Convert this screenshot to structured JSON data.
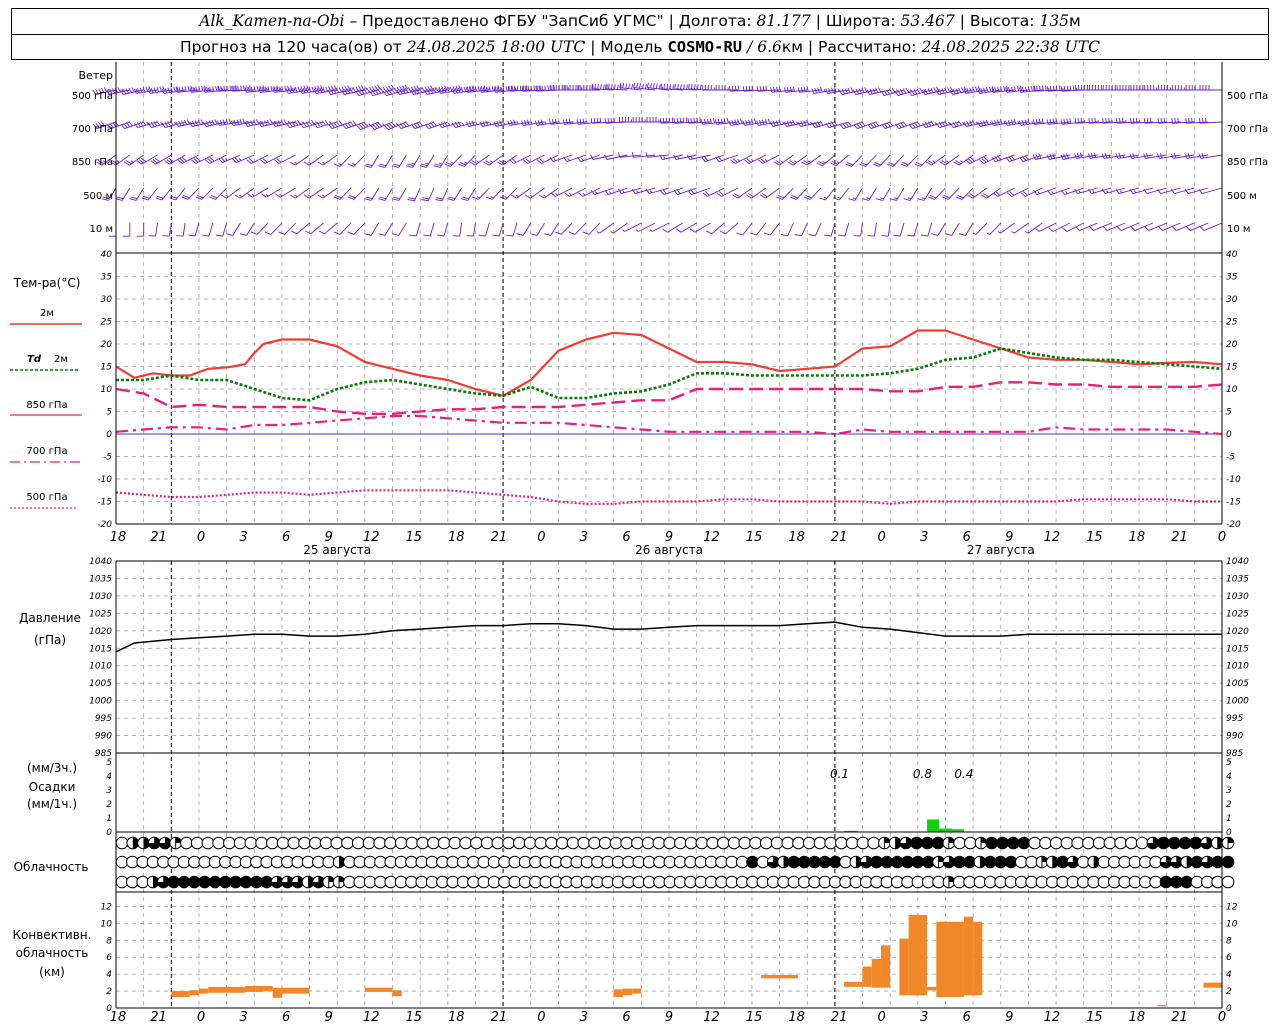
{
  "header": {
    "station": "Alk_Kamen-na-Obi",
    "provider": "– Предоставлено ФГБУ \"ЗапСиб УГМС\"",
    "lon_label": "Долгота:",
    "lon": "81.177",
    "lat_label": "Широта:",
    "lat": "53.467",
    "alt_label": "Высота:",
    "alt": "135",
    "alt_unit": "м",
    "forecast_label": "Прогноз на 120 часа(ов)  от",
    "forecast_start": "24.08.2025 18:00 UTC",
    "model_label": "Модель",
    "model": "COSMO-RU",
    "resolution": "/ 6.6",
    "res_unit": "км",
    "calc_label": "Рассчитано:",
    "calc_time": "24.08.2025 22:38 UTC"
  },
  "labels": {
    "wind": "Ветер",
    "wind_levels": [
      "500 гПа",
      "700 гПа",
      "850 гПа",
      "500 м",
      "10  м"
    ],
    "temp_title": "Тем-ра(°С)",
    "temp_legend": [
      {
        "text": "2м",
        "prefix": ""
      },
      {
        "text": "2м",
        "prefix": "Td"
      },
      {
        "text": "850 гПа",
        "prefix": ""
      },
      {
        "text": "700 гПа",
        "prefix": ""
      },
      {
        "text": "500 гПа",
        "prefix": ""
      }
    ],
    "pressure_title": "Давление",
    "pressure_unit": "(гПа)",
    "precip_unit_top": "(мм/3ч.)",
    "precip_title": "Осадки",
    "precip_unit_bottom": "(мм/1ч.)",
    "cloud_title": "Облачность",
    "conv_title": [
      "Конвективн.",
      "облачность",
      "(км)"
    ]
  },
  "colors": {
    "wind": "#6a1fd0",
    "t2m": "#f03c32",
    "td": "#0a7a0a",
    "t850": "#e8207a",
    "t700": "#e8207a",
    "t500": "#e8207a",
    "zero_line": "#3030ff",
    "pressure": "#000000",
    "precip": "#10d010",
    "conv": "#f0882a",
    "grid": "#a0a0a0"
  },
  "chart_data": {
    "type": "meteogram",
    "time_ticks": [
      "18",
      "21",
      "0",
      "3",
      "6",
      "9",
      "12",
      "15",
      "18",
      "21",
      "0",
      "3",
      "6",
      "9",
      "12",
      "15",
      "18",
      "21",
      "0",
      "3",
      "6",
      "9",
      "12",
      "15",
      "18",
      "21",
      "0"
    ],
    "days": [
      "25 августа",
      "26 августа",
      "27 августа"
    ],
    "temperature": {
      "ylim": [
        -20,
        40
      ],
      "yticks": [
        40,
        35,
        30,
        25,
        20,
        15,
        10,
        5,
        0,
        -5,
        -10,
        -15,
        -20
      ],
      "series": [
        {
          "key": "t2m",
          "style": "solid",
          "x": [
            0,
            2,
            4,
            6,
            8,
            10,
            12,
            14,
            15,
            16,
            18,
            21,
            24,
            27,
            30,
            33,
            36,
            39,
            42,
            45,
            48,
            51,
            54,
            57,
            60,
            63,
            66,
            69,
            72,
            75,
            78,
            81,
            84,
            87,
            90,
            93,
            96,
            99,
            102,
            105,
            108,
            111,
            114,
            117,
            120
          ],
          "y": [
            15,
            12.5,
            13.5,
            13,
            13,
            14.5,
            14.8,
            15.5,
            18,
            20,
            21,
            21,
            19.5,
            16,
            14.5,
            13,
            12,
            10,
            8.5,
            12,
            18.5,
            21,
            22.5,
            22,
            19,
            16,
            16,
            15.5,
            14,
            14.5,
            15,
            19,
            19.5,
            23,
            23,
            21,
            19,
            17,
            16.5,
            16.5,
            16,
            15.5,
            15.8,
            16,
            15.5
          ]
        },
        {
          "key": "td",
          "style": "dotted-bold",
          "x": [
            0,
            3,
            6,
            9,
            12,
            15,
            18,
            21,
            24,
            27,
            30,
            33,
            36,
            39,
            42,
            45,
            48,
            51,
            54,
            57,
            60,
            63,
            66,
            69,
            72,
            75,
            78,
            81,
            84,
            87,
            90,
            93,
            96,
            99,
            102,
            105,
            108,
            111,
            114,
            117,
            120
          ],
          "y": [
            12,
            12,
            13,
            12,
            12,
            10,
            8,
            7.5,
            10,
            11.5,
            12,
            11,
            10,
            9,
            8.5,
            10.5,
            8,
            8,
            9,
            9.5,
            11,
            13.5,
            13.5,
            13,
            13,
            13,
            13,
            13,
            13.5,
            14.5,
            16.5,
            17,
            19,
            18,
            17,
            16.5,
            16.5,
            16,
            15.5,
            15,
            14.5
          ]
        },
        {
          "key": "t850",
          "style": "longdash",
          "x": [
            0,
            3,
            6,
            9,
            12,
            15,
            18,
            21,
            24,
            27,
            30,
            33,
            36,
            39,
            42,
            45,
            48,
            51,
            54,
            57,
            60,
            63,
            66,
            69,
            72,
            75,
            78,
            81,
            84,
            87,
            90,
            93,
            96,
            99,
            102,
            105,
            108,
            111,
            114,
            117,
            120
          ],
          "y": [
            10,
            9,
            6,
            6.5,
            6,
            6,
            6,
            6,
            5,
            4.5,
            4.5,
            5,
            5.5,
            5.5,
            6,
            6,
            6,
            6.5,
            7,
            7.5,
            7.5,
            10,
            10,
            10,
            10,
            10,
            10,
            10,
            9.5,
            9.5,
            10.5,
            10.5,
            11.5,
            11.5,
            11,
            11,
            10.5,
            10.5,
            10.5,
            10.5,
            11
          ]
        },
        {
          "key": "t700",
          "style": "dashdot",
          "x": [
            0,
            3,
            6,
            9,
            12,
            15,
            18,
            21,
            24,
            27,
            30,
            33,
            36,
            39,
            42,
            45,
            48,
            51,
            54,
            57,
            60,
            63,
            66,
            69,
            72,
            75,
            78,
            81,
            84,
            87,
            90,
            93,
            96,
            99,
            102,
            105,
            108,
            111,
            114,
            117,
            120
          ],
          "y": [
            0.5,
            1,
            1.5,
            1.5,
            1,
            2,
            2,
            2.5,
            3,
            3.5,
            4,
            4,
            3.5,
            3,
            2.5,
            2.5,
            2.5,
            2,
            1.5,
            1,
            0.5,
            0.5,
            0.5,
            0.5,
            0.5,
            0.5,
            0,
            1,
            0.5,
            0.5,
            0.5,
            0.5,
            0.5,
            0.5,
            1.5,
            1,
            1,
            1,
            1,
            0.5,
            0
          ]
        },
        {
          "key": "t500",
          "style": "dotted",
          "x": [
            0,
            3,
            6,
            9,
            12,
            15,
            18,
            21,
            24,
            27,
            30,
            33,
            36,
            39,
            42,
            45,
            48,
            51,
            54,
            57,
            60,
            63,
            66,
            69,
            72,
            75,
            78,
            81,
            84,
            87,
            90,
            93,
            96,
            99,
            102,
            105,
            108,
            111,
            114,
            117,
            120
          ],
          "y": [
            -13,
            -13.5,
            -14,
            -14,
            -13.5,
            -13,
            -13,
            -13.5,
            -13,
            -12.5,
            -12.5,
            -12.5,
            -12.5,
            -13,
            -13.5,
            -14,
            -15,
            -15.5,
            -15.5,
            -15,
            -15,
            -15,
            -14.5,
            -14.5,
            -15,
            -15,
            -15,
            -15,
            -15.5,
            -15,
            -15,
            -15,
            -15,
            -15,
            -15,
            -14.5,
            -14.5,
            -14.5,
            -14.5,
            -15,
            -15
          ]
        }
      ]
    },
    "pressure": {
      "ylim": [
        985,
        1040
      ],
      "yticks": [
        1040,
        1035,
        1030,
        1025,
        1020,
        1015,
        1010,
        1005,
        1000,
        995,
        990,
        985
      ],
      "x": [
        0,
        2,
        4,
        6,
        9,
        12,
        15,
        18,
        21,
        24,
        27,
        30,
        33,
        36,
        39,
        42,
        45,
        48,
        51,
        54,
        57,
        60,
        63,
        66,
        69,
        72,
        75,
        78,
        81,
        84,
        87,
        90,
        93,
        96,
        99,
        102,
        105,
        108,
        111,
        114,
        117,
        120
      ],
      "y": [
        1014,
        1016.5,
        1017,
        1017.5,
        1018,
        1018.5,
        1019,
        1019,
        1018.5,
        1018.5,
        1019,
        1020,
        1020.5,
        1021,
        1021.5,
        1021.5,
        1022,
        1022,
        1021.5,
        1020.5,
        1020.5,
        1021,
        1021.5,
        1021.5,
        1021.5,
        1021.5,
        1022,
        1022.5,
        1021,
        1020.5,
        1019.5,
        1018.5,
        1018.5,
        1018.5,
        1019,
        1019,
        1019,
        1019,
        1019,
        1019,
        1019,
        1019
      ]
    },
    "precipitation": {
      "ylim": [
        0,
        5
      ],
      "yticks": [
        5,
        4,
        3,
        2,
        1,
        0
      ],
      "bars": [
        {
          "x": 79,
          "w": 1.5,
          "v": 0.08
        },
        {
          "x": 88,
          "w": 1.3,
          "v": 0.9
        },
        {
          "x": 89.3,
          "w": 1.4,
          "v": 0.25
        },
        {
          "x": 90.7,
          "w": 1.3,
          "v": 0.2
        }
      ],
      "labels": [
        {
          "x": 78.5,
          "text": "0.1"
        },
        {
          "x": 87.5,
          "text": "0.8"
        },
        {
          "x": 92,
          "text": "0.4"
        }
      ]
    },
    "cloudiness": {
      "rows": [
        [
          0,
          4,
          4,
          6,
          6,
          2,
          0,
          0,
          0,
          0,
          0,
          0,
          0,
          0,
          0,
          0,
          0,
          0,
          0,
          0,
          0,
          0,
          0,
          0,
          0,
          0,
          0,
          0,
          0,
          0,
          0,
          0,
          0,
          0,
          0,
          0,
          0,
          0,
          0,
          0,
          0,
          0,
          0,
          0,
          0,
          0,
          0,
          0,
          0,
          0,
          0,
          0,
          0,
          0,
          0,
          0,
          0,
          0,
          0,
          0,
          0,
          0,
          0,
          0,
          0,
          0,
          0,
          0,
          0,
          0,
          0,
          2,
          4,
          6,
          8,
          8,
          8,
          2,
          0,
          0,
          2,
          8,
          8,
          8,
          8,
          0,
          0,
          0,
          0,
          0,
          0,
          0,
          0,
          0,
          0,
          0,
          6,
          8,
          8,
          8,
          8,
          6,
          4,
          2
        ],
        [
          0,
          0,
          0,
          0,
          0,
          0,
          0,
          0,
          0,
          0,
          0,
          0,
          0,
          0,
          0,
          0,
          0,
          0,
          0,
          0,
          0,
          4,
          0,
          0,
          0,
          0,
          0,
          0,
          0,
          0,
          0,
          0,
          0,
          0,
          0,
          0,
          0,
          0,
          0,
          0,
          0,
          0,
          0,
          0,
          0,
          0,
          0,
          0,
          0,
          0,
          0,
          0,
          0,
          0,
          0,
          0,
          0,
          0,
          0,
          0,
          0,
          8,
          0,
          6,
          4,
          8,
          8,
          8,
          8,
          8,
          0,
          4,
          6,
          8,
          8,
          8,
          8,
          8,
          8,
          2,
          6,
          8,
          8,
          4,
          8,
          8,
          8,
          0,
          0,
          2,
          4,
          8,
          6,
          0,
          4,
          0,
          0,
          0,
          0,
          0,
          0,
          6,
          6,
          4,
          8,
          6,
          8,
          8
        ],
        [
          0,
          0,
          0,
          4,
          6,
          8,
          8,
          8,
          8,
          8,
          8,
          8,
          8,
          8,
          8,
          6,
          6,
          6,
          4,
          6,
          2,
          2,
          0,
          0,
          0,
          0,
          0,
          0,
          0,
          0,
          0,
          0,
          0,
          0,
          0,
          0,
          0,
          0,
          0,
          0,
          0,
          0,
          0,
          0,
          0,
          0,
          0,
          0,
          0,
          0,
          0,
          0,
          0,
          0,
          0,
          0,
          0,
          0,
          0,
          0,
          0,
          0,
          0,
          0,
          0,
          0,
          0,
          0,
          0,
          0,
          0,
          0,
          0,
          0,
          0,
          0,
          0,
          0,
          0,
          0,
          2,
          0,
          0,
          0,
          0,
          0,
          0,
          0,
          0,
          0,
          0,
          0,
          0,
          0,
          0,
          0,
          0,
          0,
          0,
          0,
          0,
          8,
          8,
          8,
          0,
          0,
          0,
          0
        ]
      ]
    },
    "convective": {
      "ylim": [
        0,
        13
      ],
      "yticks": [
        12,
        10,
        8,
        6,
        4,
        2,
        0
      ],
      "bars": [
        {
          "x0": 6,
          "x1": 8,
          "b": 1.3,
          "t": 2.0
        },
        {
          "x0": 8,
          "x1": 9,
          "b": 1.5,
          "t": 2.1
        },
        {
          "x0": 9,
          "x1": 10,
          "b": 1.7,
          "t": 2.3
        },
        {
          "x0": 10,
          "x1": 14,
          "b": 1.8,
          "t": 2.5
        },
        {
          "x0": 14,
          "x1": 16,
          "b": 1.9,
          "t": 2.6
        },
        {
          "x0": 16,
          "x1": 17,
          "b": 2.0,
          "t": 2.6
        },
        {
          "x0": 17,
          "x1": 18,
          "b": 1.2,
          "t": 2.4
        },
        {
          "x0": 18,
          "x1": 21,
          "b": 1.7,
          "t": 2.4
        },
        {
          "x0": 27,
          "x1": 30,
          "b": 1.9,
          "t": 2.4
        },
        {
          "x0": 30,
          "x1": 31,
          "b": 1.4,
          "t": 2.1
        },
        {
          "x0": 54,
          "x1": 55,
          "b": 1.3,
          "t": 2.2
        },
        {
          "x0": 55,
          "x1": 56,
          "b": 1.5,
          "t": 2.3
        },
        {
          "x0": 56,
          "x1": 57,
          "b": 1.7,
          "t": 2.3
        },
        {
          "x0": 70,
          "x1": 74,
          "b": 3.5,
          "t": 3.9
        },
        {
          "x0": 79,
          "x1": 81,
          "b": 2.5,
          "t": 3.1
        },
        {
          "x0": 81,
          "x1": 82,
          "b": 2.5,
          "t": 4.9
        },
        {
          "x0": 82,
          "x1": 83,
          "b": 2.4,
          "t": 5.8
        },
        {
          "x0": 83,
          "x1": 84,
          "b": 2.4,
          "t": 7.4
        },
        {
          "x0": 85,
          "x1": 86,
          "b": 1.5,
          "t": 8.2
        },
        {
          "x0": 86,
          "x1": 88,
          "b": 1.5,
          "t": 11.0
        },
        {
          "x0": 88,
          "x1": 89,
          "b": 2.1,
          "t": 2.5
        },
        {
          "x0": 89,
          "x1": 90,
          "b": 1.3,
          "t": 10.2
        },
        {
          "x0": 90,
          "x1": 92,
          "b": 1.3,
          "t": 10.2
        },
        {
          "x0": 92,
          "x1": 93,
          "b": 1.5,
          "t": 10.8
        },
        {
          "x0": 93,
          "x1": 94,
          "b": 1.5,
          "t": 10.2
        },
        {
          "x0": 113,
          "x1": 114,
          "b": 0.2,
          "t": 0.35
        },
        {
          "x0": 118,
          "x1": 120,
          "b": 2.4,
          "t": 3.0
        }
      ]
    }
  }
}
